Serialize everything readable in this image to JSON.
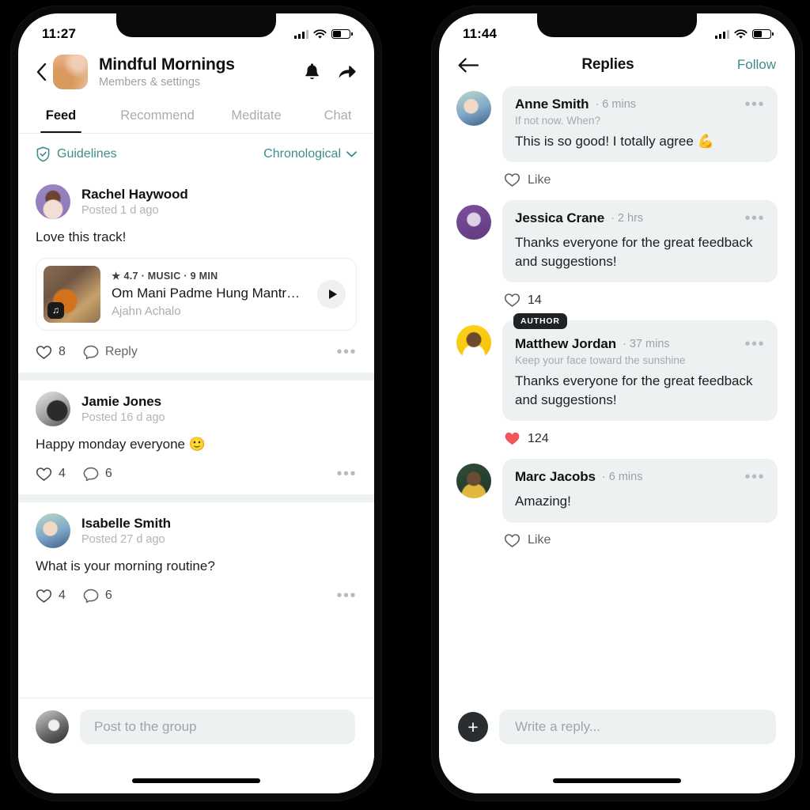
{
  "left_phone": {
    "status": {
      "time": "11:27",
      "battery_pct": 50
    },
    "header": {
      "back_icon": "chevron-left-icon",
      "group_avatar": "group-avatar",
      "title": "Mindful Mornings",
      "subtitle": "Members & settings",
      "bell_icon": "bell-icon",
      "share_icon": "share-arrow-icon"
    },
    "tabs": [
      {
        "label": "Feed",
        "active": true
      },
      {
        "label": "Recommend",
        "active": false
      },
      {
        "label": "Meditate",
        "active": false
      },
      {
        "label": "Chat",
        "active": false
      }
    ],
    "subbar": {
      "guidelines_label": "Guidelines",
      "guidelines_icon": "shield-check-icon",
      "sort_label": "Chronological",
      "sort_icon": "chevron-down-icon",
      "accent_color": "#3f8c8c"
    },
    "posts": [
      {
        "author": "Rachel Haywood",
        "meta": "Posted 1 d ago",
        "text": "Love this track!",
        "track": {
          "rating": "4.7",
          "kicker": "4.7 · MUSIC · 9 MIN",
          "title": "Om Mani Padme Hung Mantra Of ...",
          "artist": "Ajahn Achalo",
          "play_icon": "play-icon",
          "badge_icon": "music-note-icon"
        },
        "like_count": "8",
        "reply_label": "Reply",
        "more_icon": "more-dots-icon"
      },
      {
        "author": "Jamie Jones",
        "meta": "Posted 16 d ago",
        "text": "Happy monday everyone 🙂",
        "like_count": "4",
        "reply_count": "6",
        "more_icon": "more-dots-icon"
      },
      {
        "author": "Isabelle Smith",
        "meta": "Posted 27 d ago",
        "text": "What is your morning routine?",
        "like_count": "4",
        "reply_count": "6",
        "more_icon": "more-dots-icon"
      }
    ],
    "composer": {
      "placeholder": "Post to the group",
      "avatar": "my-avatar"
    }
  },
  "right_phone": {
    "status": {
      "time": "11:44",
      "battery_pct": 50
    },
    "header": {
      "back_icon": "arrow-left-icon",
      "title": "Replies",
      "follow_label": "Follow",
      "accent_color": "#3f8c8c"
    },
    "replies": [
      {
        "author": "Anne Smith",
        "time": "· 6 mins",
        "tagline": "If not now. When?",
        "body": "This is so good! I totally agree 💪",
        "action_label": "Like",
        "liked": false,
        "author_badge": null,
        "more_icon": "more-dots-icon"
      },
      {
        "author": "Jessica Crane",
        "time": "· 2 hrs",
        "tagline": null,
        "body": "Thanks everyone for the great feedback and suggestions!",
        "action_label": "14",
        "liked": false,
        "author_badge": null,
        "more_icon": "more-dots-icon"
      },
      {
        "author": "Matthew Jordan",
        "time": "· 37 mins",
        "tagline": "Keep your face toward the sunshine",
        "body": "Thanks everyone for the great feedback and suggestions!",
        "action_label": "124",
        "liked": true,
        "author_badge": "AUTHOR",
        "more_icon": "more-dots-icon"
      },
      {
        "author": "Marc Jacobs",
        "time": "· 6 mins",
        "tagline": null,
        "body": "Amazing!",
        "action_label": "Like",
        "liked": false,
        "author_badge": null,
        "more_icon": "more-dots-icon"
      }
    ],
    "composer": {
      "placeholder": "Write a reply...",
      "plus_icon": "plus-icon"
    }
  }
}
